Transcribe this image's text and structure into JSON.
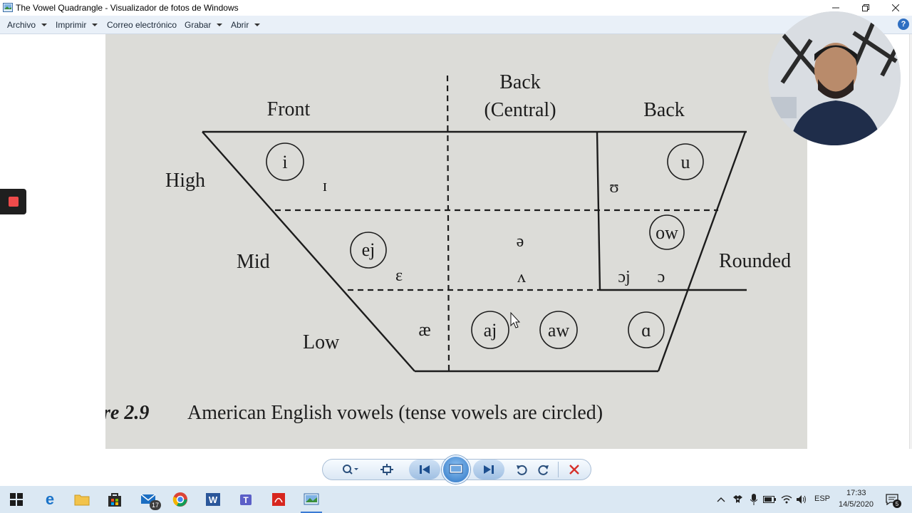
{
  "window": {
    "title": "The Vowel Quadrangle - Visualizador de fotos de Windows"
  },
  "menu": {
    "items": [
      {
        "label": "Archivo",
        "has_caret": true
      },
      {
        "label": "Imprimir",
        "has_caret": true
      },
      {
        "label": "Correo electrónico",
        "has_caret": false
      },
      {
        "label": "Grabar",
        "has_caret": true
      },
      {
        "label": "Abrir",
        "has_caret": true
      }
    ],
    "help_label": "?"
  },
  "photo": {
    "col_front": "Front",
    "col_back_central_1": "Back",
    "col_back_central_2": "(Central)",
    "col_back": "Back",
    "row_high": "High",
    "row_mid": "Mid",
    "row_low": "Low",
    "side_rounded": "Rounded",
    "vowels": {
      "i": "i",
      "ih": "ɪ",
      "u": "u",
      "uh": "ʊ",
      "ej": "ej",
      "eh": "ɛ",
      "schwa": "ə",
      "wedge": "ʌ",
      "ow": "ow",
      "oj": "ɔj",
      "open_o": "ɔ",
      "ae": "æ",
      "aj": "aj",
      "aw": "aw",
      "a": "ɑ"
    },
    "caption_fig": "re 2.9",
    "caption_text": "American English vowels (tense vowels are circled)"
  },
  "taskbar": {
    "mail_badge": "17",
    "lang": "ESP",
    "time": "17:33",
    "date": "14/5/2020",
    "notif_count": "5"
  },
  "colors": {
    "paper": "#dcdcd8",
    "ink": "#1c1c1c",
    "menubar": "#e9f0f8",
    "taskbar": "#dbe8f3",
    "record": "#ef4b4b"
  }
}
